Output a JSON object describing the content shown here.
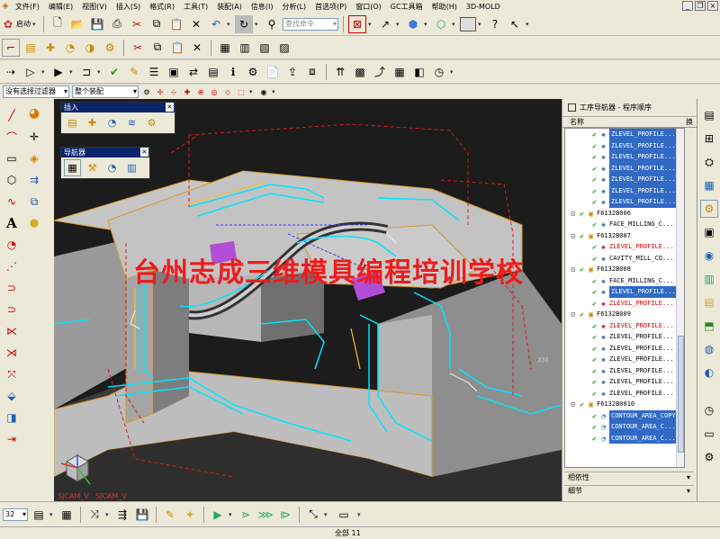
{
  "menu": [
    "文件(F)",
    "编辑(E)",
    "视图(V)",
    "插入(S)",
    "格式(R)",
    "工具(T)",
    "装配(A)",
    "信息(I)",
    "分析(L)",
    "首选项(P)",
    "窗口(O)",
    "GC工具箱",
    "帮助(H)",
    "3D-MOLD"
  ],
  "start_button": "启动",
  "command_search": {
    "placeholder": "查找命令"
  },
  "filter": {
    "type_filter": "没有选择过滤器",
    "scope": "整个装配"
  },
  "palettes": {
    "insert_title": "插入",
    "navigator_title": "导航器"
  },
  "watermark": "台州志成三维模具编程培训学校",
  "axis": {
    "xm": "XM",
    "wcs1": "SJCAM_V",
    "wcs2": "SJCAM_V"
  },
  "navigator": {
    "title": "工序导航器 - 程序顺序",
    "col_name": "名称",
    "col_change": "换",
    "rows": [
      {
        "indent": 2,
        "icon": "op",
        "label": "ZLEVEL_PROFILE...",
        "selected": true
      },
      {
        "indent": 2,
        "icon": "op",
        "label": "ZLEVEL_PROFILE...",
        "selected": true
      },
      {
        "indent": 2,
        "icon": "op",
        "label": "ZLEVEL_PROFILE...",
        "selected": true
      },
      {
        "indent": 2,
        "icon": "op",
        "label": "ZLEVEL_PROFILE...",
        "selected": true
      },
      {
        "indent": 2,
        "icon": "op",
        "label": "ZLEVEL_PROFILE...",
        "selected": true
      },
      {
        "indent": 2,
        "icon": "op",
        "label": "ZLEVEL_PROFILE...",
        "selected": true
      },
      {
        "indent": 2,
        "icon": "op",
        "label": "ZLEVEL_PROFILE...",
        "selected": true
      },
      {
        "indent": 1,
        "icon": "group",
        "label": "F6132B006",
        "selected": false
      },
      {
        "indent": 2,
        "icon": "op",
        "label": "FACE_MILLING_C...",
        "selected": false
      },
      {
        "indent": 1,
        "icon": "group",
        "label": "F6132B007",
        "selected": false
      },
      {
        "indent": 2,
        "icon": "op-red",
        "label": "ZLEVEL_PROFILE...",
        "selected": false
      },
      {
        "indent": 2,
        "icon": "op",
        "label": "CAVITY_MILL_CO...",
        "selected": false
      },
      {
        "indent": 1,
        "icon": "group",
        "label": "F6132B008",
        "selected": false
      },
      {
        "indent": 2,
        "icon": "op",
        "label": "FACE_MILLING_C...",
        "selected": false
      },
      {
        "indent": 2,
        "icon": "op",
        "label": "ZLEVEL_PROFILE...",
        "selected": true
      },
      {
        "indent": 2,
        "icon": "op-red",
        "label": "ZLEVEL_PROFILE...",
        "selected": false
      },
      {
        "indent": 1,
        "icon": "group",
        "label": "F6132B009",
        "selected": false
      },
      {
        "indent": 2,
        "icon": "op-red",
        "label": "ZLEVEL_PROFILE...",
        "selected": false
      },
      {
        "indent": 2,
        "icon": "op",
        "label": "ZLEVEL_PROFILE...",
        "selected": false
      },
      {
        "indent": 2,
        "icon": "op",
        "label": "ZLEVEL_PROFILE...",
        "selected": false
      },
      {
        "indent": 2,
        "icon": "op",
        "label": "ZLEVEL_PROFILE...",
        "selected": false
      },
      {
        "indent": 2,
        "icon": "op",
        "label": "ZLEVEL_PROFILE...",
        "selected": false
      },
      {
        "indent": 2,
        "icon": "op",
        "label": "ZLEVEL_PROFILE...",
        "selected": false
      },
      {
        "indent": 2,
        "icon": "op",
        "label": "ZLEVEL_PROFILE...",
        "selected": false
      },
      {
        "indent": 1,
        "icon": "group",
        "label": "F6132B0010",
        "selected": false
      },
      {
        "indent": 2,
        "icon": "op-contour",
        "label": "CONTOUR_AREA_COPY",
        "selected": true
      },
      {
        "indent": 2,
        "icon": "op-contour",
        "label": "CONTOUR_AREA_C...",
        "selected": true
      },
      {
        "indent": 2,
        "icon": "op-contour",
        "label": "CONTOUR_AREA_C...",
        "selected": true
      }
    ],
    "dependencies": "相依性",
    "details": "细节"
  },
  "status": {
    "text": "全部 11"
  },
  "bottom": {
    "scale": "32"
  },
  "colors": {
    "selection": "#316ac5",
    "watermark": "#ee1c1c",
    "toolpath": "#00e5ff",
    "part": "#c8c8c8",
    "viewport_bg": "#1c1c1c"
  }
}
